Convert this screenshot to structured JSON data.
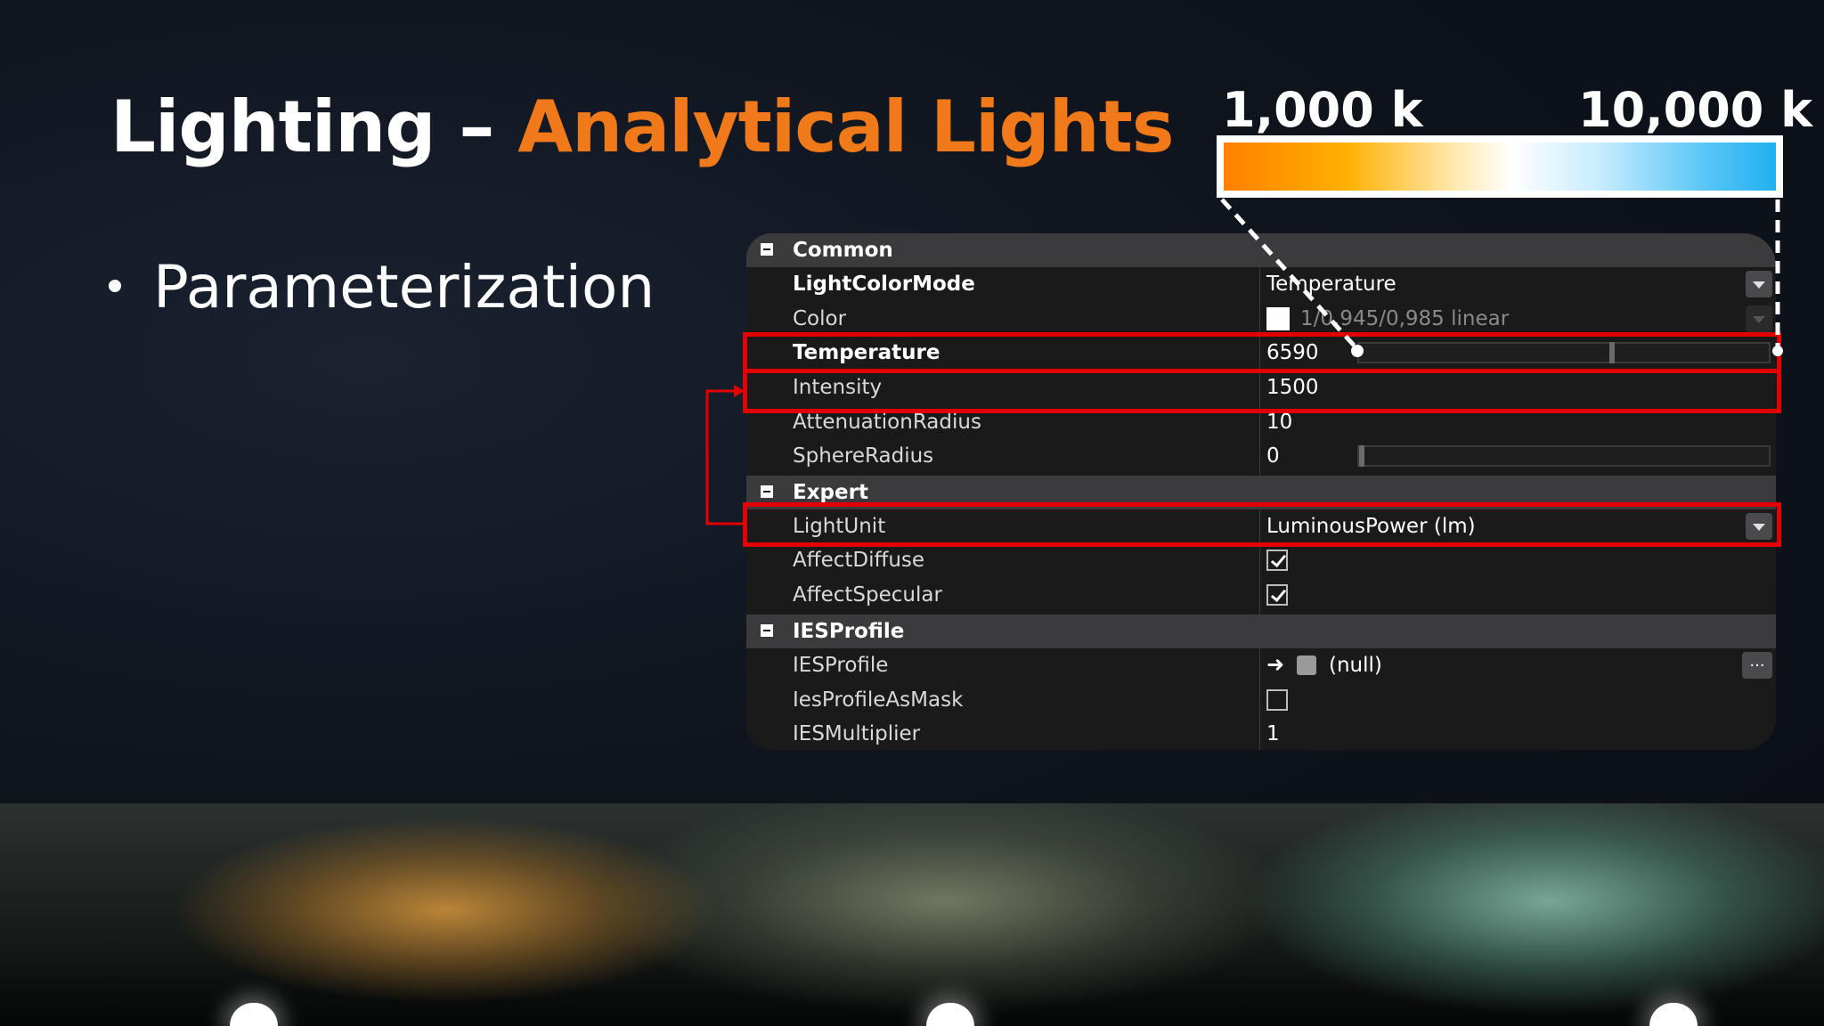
{
  "slide": {
    "title_main": "Lighting –",
    "title_accent": "Analytical Lights",
    "bullet": "Parameterization",
    "temp_min_label": "1,000 k",
    "temp_max_label": "10,000 k"
  },
  "colors": {
    "accent": "#f07a1a",
    "highlight": "#e40000",
    "panel_bg": "#1a1a1b",
    "section_bg": "#3b3b3d"
  },
  "sections": {
    "common": "Common",
    "expert": "Expert",
    "ies": "IESProfile"
  },
  "props": {
    "light_color_mode": {
      "name": "LightColorMode",
      "value": "Temperature"
    },
    "color": {
      "name": "Color",
      "value": "1/0,945/0,985 linear"
    },
    "temperature": {
      "name": "Temperature",
      "value": "6590"
    },
    "intensity": {
      "name": "Intensity",
      "value": "1500"
    },
    "attenuation_radius": {
      "name": "AttenuationRadius",
      "value": "10"
    },
    "sphere_radius": {
      "name": "SphereRadius",
      "value": "0"
    },
    "light_unit": {
      "name": "LightUnit",
      "value": "LuminousPower (lm)"
    },
    "affect_diffuse": {
      "name": "AffectDiffuse",
      "checked": true
    },
    "affect_specular": {
      "name": "AffectSpecular",
      "checked": true
    },
    "ies_profile": {
      "name": "IESProfile",
      "value": "(null)",
      "button": "..."
    },
    "ies_as_mask": {
      "name": "IesProfileAsMask",
      "checked": false
    },
    "ies_multiplier": {
      "name": "IESMultiplier",
      "value": "1"
    }
  },
  "sliders": {
    "temperature_fraction": 0.62,
    "sphere_radius_fraction": 0.0
  }
}
